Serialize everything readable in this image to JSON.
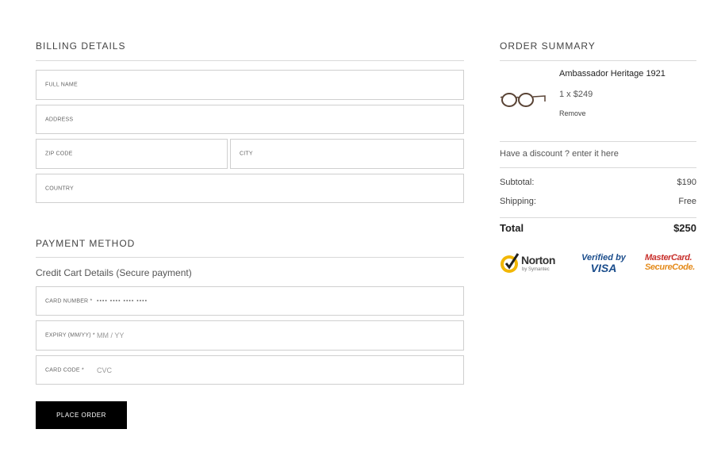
{
  "billing": {
    "title": "BILLING DETAILS",
    "fields": {
      "full_name": "FULL NAME",
      "address": "ADDRESS",
      "zip_code": "ZIP CODE",
      "city": "CITY",
      "country": "COUNTRY"
    }
  },
  "payment": {
    "title": "PAYMENT METHOD",
    "subtitle": "Credit Cart Details (Secure payment)",
    "card_number": {
      "label": "CARD NUMBER *",
      "placeholder": "•••• •••• •••• ••••"
    },
    "expiry": {
      "label": "EXPIRY (MM/YY) *",
      "placeholder": "MM / YY"
    },
    "card_code": {
      "label": "CARD CODE *",
      "placeholder": "CVC"
    },
    "place_order": "PLACE ORDER"
  },
  "summary": {
    "title": "ORDER SUMMARY",
    "item": {
      "name": "Ambassador Heritage 1921",
      "qty_price": "1 x $249",
      "remove": "Remove",
      "image_icon": "eyeglasses-icon"
    },
    "discount": "Have a discount ? enter it here",
    "subtotal_label": "Subtotal:",
    "subtotal_value": "$190",
    "shipping_label": "Shipping:",
    "shipping_value": "Free",
    "total_label": "Total",
    "total_value": "$250"
  },
  "badges": {
    "norton": {
      "name": "Norton",
      "sub": "by Symantec"
    },
    "visa": {
      "line1": "Verified by",
      "line2": "VISA"
    },
    "mastercard": {
      "line1": "MasterCard.",
      "line2": "SecureCode."
    }
  },
  "colors": {
    "button_bg": "#000000",
    "norton_yellow": "#f2b705",
    "visa_blue": "#1a4c8b",
    "mastercard_red": "#c8302c",
    "mastercard_orange": "#e48b1c"
  }
}
